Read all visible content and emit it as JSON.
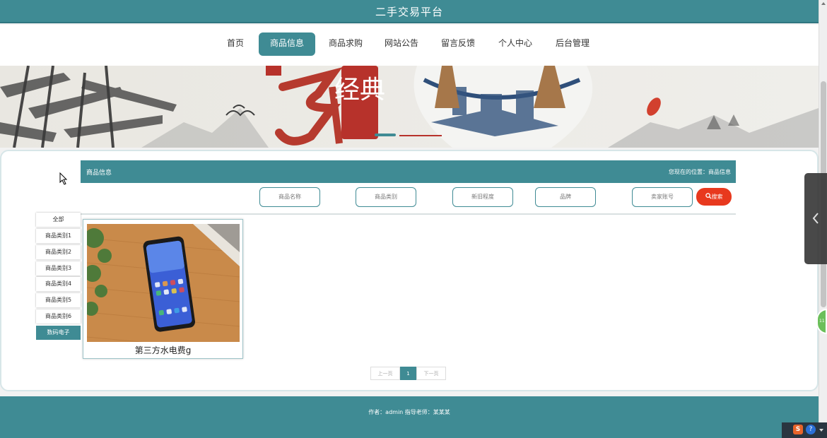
{
  "site": {
    "title": "二手交易平台"
  },
  "nav": {
    "items": [
      {
        "label": "首页"
      },
      {
        "label": "商品信息"
      },
      {
        "label": "商品求购"
      },
      {
        "label": "网站公告"
      },
      {
        "label": "留言反馈"
      },
      {
        "label": "个人中心"
      },
      {
        "label": "后台管理"
      }
    ],
    "active_index": 1
  },
  "banner": {
    "calligraphy": "经典"
  },
  "breadcrumb": {
    "title": "商品信息",
    "location": "您现在的位置：商品信息"
  },
  "filters": {
    "name_placeholder": "商品名称",
    "category_placeholder": "商品类别",
    "condition_placeholder": "新旧程度",
    "brand_placeholder": "品牌",
    "seller_placeholder": "卖家账号",
    "search_label": "搜索"
  },
  "categories": {
    "items": [
      "全部",
      "商品类别1",
      "商品类别2",
      "商品类别3",
      "商品类别4",
      "商品类别5",
      "商品类别6",
      "数码电子"
    ],
    "active": "数码电子"
  },
  "products": [
    {
      "name": "第三方水电费g"
    }
  ],
  "pagination": {
    "prev": "上一页",
    "current": "1",
    "next": "下一页"
  },
  "footer": {
    "text": "作者：admin 指导老师：某某某"
  },
  "colors": {
    "primary": "#3f8b94",
    "search": "#e8391e",
    "background": "#f2f2f2"
  }
}
